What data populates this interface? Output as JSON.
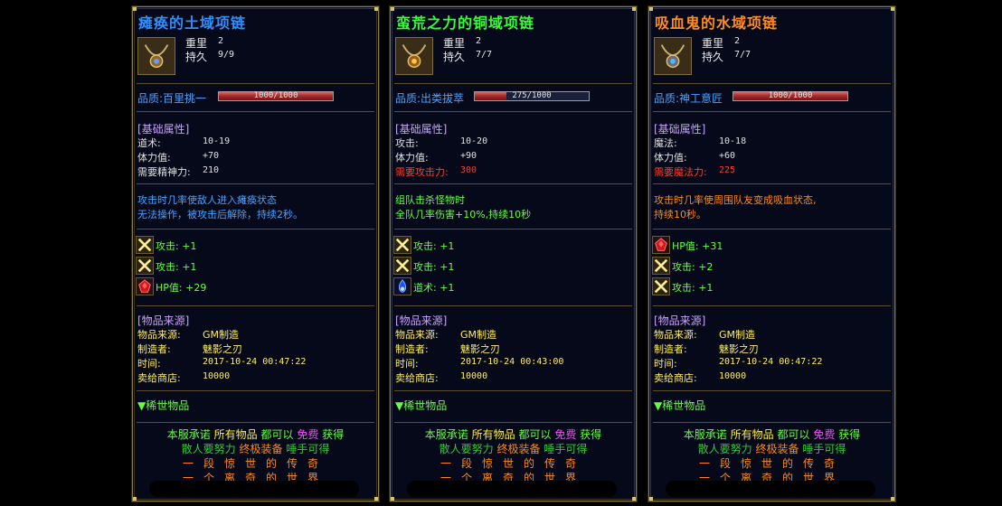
{
  "labels": {
    "weight": "重里",
    "durability": "持久",
    "quality_prefix": "品质:",
    "base_attrs": "[基础属性]",
    "item_source": "[物品来源]",
    "source_k": "物品来源:",
    "maker_k": "制造者:",
    "time_k": "时间:",
    "sell_k": "卖给商店:",
    "rare": "▼稀世物品"
  },
  "promo": {
    "l1a": "本服承诺",
    "l1b": "所有物品",
    "l1c": "都可以",
    "l1d": "免费",
    "l1e": "获得",
    "l2a": "散人要努力",
    "l2b": "终极装备",
    "l2c": "唾手可得",
    "l3": "一段惊世的传奇",
    "l4": "一个离奇的世界"
  },
  "items": [
    {
      "title": "瘫痪的土域项链",
      "title_color": "#2f8fff",
      "icon": "necklace-earth-icon",
      "weight": "2",
      "durability": "9/9",
      "quality_name": "百里挑一",
      "quality_value": "1000/1000",
      "quality_fraction": 1.0,
      "attrs": [
        {
          "k": "道术:",
          "v": "10-19",
          "red": false
        },
        {
          "k": "体力值:",
          "v": "+70",
          "red": false
        },
        {
          "k": "需要精神力:",
          "v": "210",
          "red": false
        }
      ],
      "desc_color": "#4aa3ff",
      "desc": [
        "攻击时几率使敌人进入瘫痪状态",
        "无法操作，被攻击后解除，持续2秒。"
      ],
      "gems": [
        {
          "icon": "sword-cross-icon",
          "text": "攻击: +1"
        },
        {
          "icon": "sword-cross-icon",
          "text": "攻击: +1"
        },
        {
          "icon": "red-gem-icon",
          "text": "HP值: +29"
        }
      ],
      "source": "GM制造",
      "maker": "魅影之刃",
      "time": "2017-10-24 00:47:22",
      "sell": "10000"
    },
    {
      "title": "蛮荒之力的铜域项链",
      "title_color": "#33ff33",
      "icon": "necklace-copper-icon",
      "weight": "2",
      "durability": "7/7",
      "quality_name": "出类拔萃",
      "quality_value": "275/1000",
      "quality_fraction": 0.275,
      "attrs": [
        {
          "k": "攻击:",
          "v": "10-20",
          "red": false
        },
        {
          "k": "体力值:",
          "v": "+90",
          "red": false
        },
        {
          "k": "需要攻击力:",
          "v": "300",
          "red": true
        }
      ],
      "desc_color": "#66ff44",
      "desc": [
        "组队击杀怪物时",
        "全队几率伤害+10%,持续10秒"
      ],
      "gems": [
        {
          "icon": "sword-cross-icon",
          "text": "攻击: +1"
        },
        {
          "icon": "sword-cross-icon",
          "text": "攻击: +1"
        },
        {
          "icon": "blue-flame-icon",
          "text": "道术: +1"
        }
      ],
      "source": "GM制造",
      "maker": "魅影之刃",
      "time": "2017-10-24 00:43:00",
      "sell": "10000"
    },
    {
      "title": "吸血鬼的水域项链",
      "title_color": "#ff8c1a",
      "icon": "necklace-water-icon",
      "weight": "2",
      "durability": "7/7",
      "quality_name": "神工意匠",
      "quality_value": "1000/1000",
      "quality_fraction": 1.0,
      "attrs": [
        {
          "k": "魔法:",
          "v": "10-18",
          "red": false
        },
        {
          "k": "体力值:",
          "v": "+60",
          "red": false
        },
        {
          "k": "需要魔法力:",
          "v": "225",
          "red": true
        }
      ],
      "desc_color": "#ff8c1a",
      "desc": [
        "攻击时几率使周围队友变成吸血状态,",
        "持续10秒。"
      ],
      "gems": [
        {
          "icon": "red-gem-icon",
          "text": "HP值: +31"
        },
        {
          "icon": "sword-cross-icon",
          "text": "攻击: +2"
        },
        {
          "icon": "sword-cross-icon",
          "text": "攻击: +1"
        }
      ],
      "source": "GM制造",
      "maker": "魅影之刃",
      "time": "2017-10-24 00:47:22",
      "sell": "10000"
    }
  ]
}
